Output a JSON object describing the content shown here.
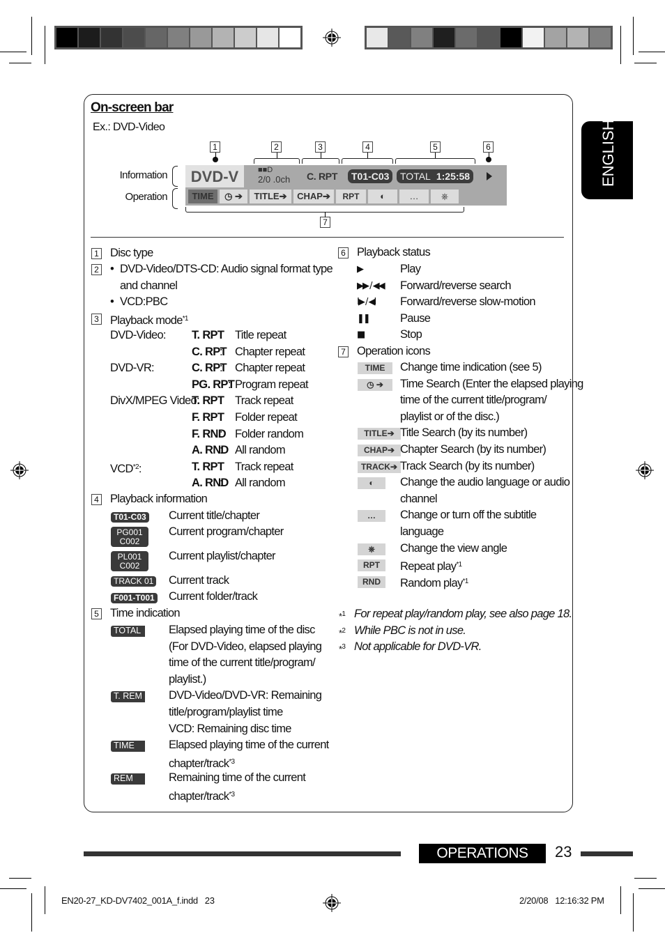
{
  "page": {
    "section_tab": "ENGLISH",
    "footer_section": "OPERATIONS",
    "page_number": "23",
    "slug_file": "EN20-27_KD-DV7402_001A_f.indd   23",
    "slug_date": "2/20/08   12:16:32 PM"
  },
  "colorbars": {
    "left": [
      "#000000",
      "#1c1c1c",
      "#333333",
      "#4c4c4c",
      "#666666",
      "#808080",
      "#999999",
      "#b3b3b3",
      "#cccccc",
      "#e6e6e6",
      "#ffffff"
    ],
    "right": [
      "#e8e8e8",
      "#595959",
      "#808080",
      "#1f1f1f",
      "#6b6b6b",
      "#555555",
      "#000000",
      "#f2f2f2",
      "#a3a3a3",
      "#b3b3b3",
      "#808080"
    ]
  },
  "onscreen": {
    "title": "On-screen bar",
    "example": "Ex.: DVD-Video",
    "information_label": "Information",
    "operation_label": "Operation",
    "callouts": [
      "1",
      "2",
      "3",
      "4",
      "5",
      "6",
      "7"
    ],
    "bar": {
      "disc": "DVD-V",
      "audio_logo": "■■D",
      "audio_channel": "2/0 .0ch",
      "mode": "C. RPT",
      "title_chapter": "T01-C03",
      "time_label": "TOTAL",
      "time_value": "1:25:58",
      "operations": [
        "TIME",
        "◷ ➔",
        "TITLE➔",
        "CHAP➔",
        "RPT",
        "◐",
        "…",
        "⎈"
      ]
    }
  },
  "left": {
    "item1": {
      "num": "1",
      "label": "Disc type"
    },
    "item2": {
      "num": "2",
      "bullet1_line1": "DVD-Video/DTS-CD: Audio signal format type",
      "bullet1_line2": "and channel",
      "bullet2": "VCD:PBC"
    },
    "item3": {
      "num": "3",
      "label": "Playback mode",
      "sup": "*1",
      "rows": [
        {
          "disc": "DVD-Video:",
          "code": "T. RPT",
          "desc": "Title repeat"
        },
        {
          "disc": "",
          "code": "C. RPT",
          "desc": "Chapter repeat"
        },
        {
          "disc": "DVD-VR:",
          "code": "C. RPT",
          "desc": "Chapter repeat"
        },
        {
          "disc": "",
          "code": "PG. RPT",
          "desc": "Program repeat"
        },
        {
          "disc": "DivX/MPEG Video:",
          "code": "T. RPT",
          "desc": "Track repeat"
        },
        {
          "disc": "",
          "code": "F. RPT",
          "desc": "Folder repeat"
        },
        {
          "disc": "",
          "code": "F. RND",
          "desc": "Folder random"
        },
        {
          "disc": "",
          "code": "A. RND",
          "desc": "All random"
        },
        {
          "disc": "VCD*2:",
          "code": "T. RPT",
          "desc": "Track repeat"
        },
        {
          "disc": "",
          "code": "A. RND",
          "desc": "All random"
        }
      ]
    },
    "item4": {
      "num": "4",
      "label": "Playback information",
      "rows": [
        {
          "badge": "T01-C03",
          "desc": "Current title/chapter"
        },
        {
          "badge_l1": "PG001",
          "badge_l2": "C002",
          "desc": "Current program/chapter"
        },
        {
          "badge_l1": "PL001",
          "badge_l2": "C002",
          "desc": "Current playlist/chapter"
        },
        {
          "badge": "TRACK 01",
          "desc": "Current track"
        },
        {
          "badge": "F001-T001",
          "desc": "Current folder/track"
        }
      ]
    },
    "item5": {
      "num": "5",
      "label": "Time indication",
      "rows": [
        {
          "badge": "TOTAL",
          "lines": [
            "Elapsed playing time of the disc",
            "(For DVD-Video, elapsed playing",
            "time of the current title/program/",
            "playlist.)"
          ]
        },
        {
          "badge": "T. REM",
          "lines": [
            "DVD-Video/DVD-VR: Remaining",
            "title/program/playlist time",
            "VCD: Remaining disc time"
          ]
        },
        {
          "badge": "TIME",
          "lines": [
            "Elapsed playing time of the current",
            "chapter/track*3"
          ]
        },
        {
          "badge": "REM",
          "lines": [
            "Remaining time of the current",
            "chapter/track*3"
          ]
        }
      ]
    }
  },
  "right": {
    "item6": {
      "num": "6",
      "label": "Playback status",
      "rows": [
        {
          "icon": "▶",
          "desc": "Play"
        },
        {
          "icon": "▶▶ / ◀◀",
          "desc": "Forward/reverse search"
        },
        {
          "icon": "I▶ / ◀I",
          "desc": "Forward/reverse slow-motion"
        },
        {
          "icon": "❚❚",
          "desc": "Pause"
        },
        {
          "icon": "■",
          "desc": "Stop"
        }
      ]
    },
    "item7": {
      "num": "7",
      "label": "Operation icons",
      "rows": [
        {
          "icon": "TIME",
          "lines": [
            "Change time indication (see 5)"
          ]
        },
        {
          "icon": "◷ ➔",
          "lines": [
            "Time Search (Enter the elapsed playing",
            "time of the current title/program/",
            "playlist or of the disc.)"
          ]
        },
        {
          "icon": "TITLE➔",
          "lines": [
            "Title Search (by its number)"
          ]
        },
        {
          "icon": "CHAP➔",
          "lines": [
            "Chapter Search (by its number)"
          ]
        },
        {
          "icon": "TRACK➔",
          "lines": [
            "Track Search (by its number)"
          ]
        },
        {
          "icon": "◐",
          "lines": [
            "Change the audio language or audio",
            "channel"
          ]
        },
        {
          "icon": "…",
          "lines": [
            "Change or turn off the subtitle",
            "language"
          ]
        },
        {
          "icon": "⎈",
          "lines": [
            "Change the view angle"
          ]
        },
        {
          "icon": "RPT",
          "lines": [
            "Repeat play*1"
          ]
        },
        {
          "icon": "RND",
          "lines": [
            "Random play*1"
          ]
        }
      ]
    },
    "footnotes": [
      {
        "mark": "*1",
        "text": "For repeat play/random play, see also page 18."
      },
      {
        "mark": "*2",
        "text": "While PBC is not in use."
      },
      {
        "mark": "*3",
        "text": "Not applicable for DVD-VR."
      }
    ]
  }
}
